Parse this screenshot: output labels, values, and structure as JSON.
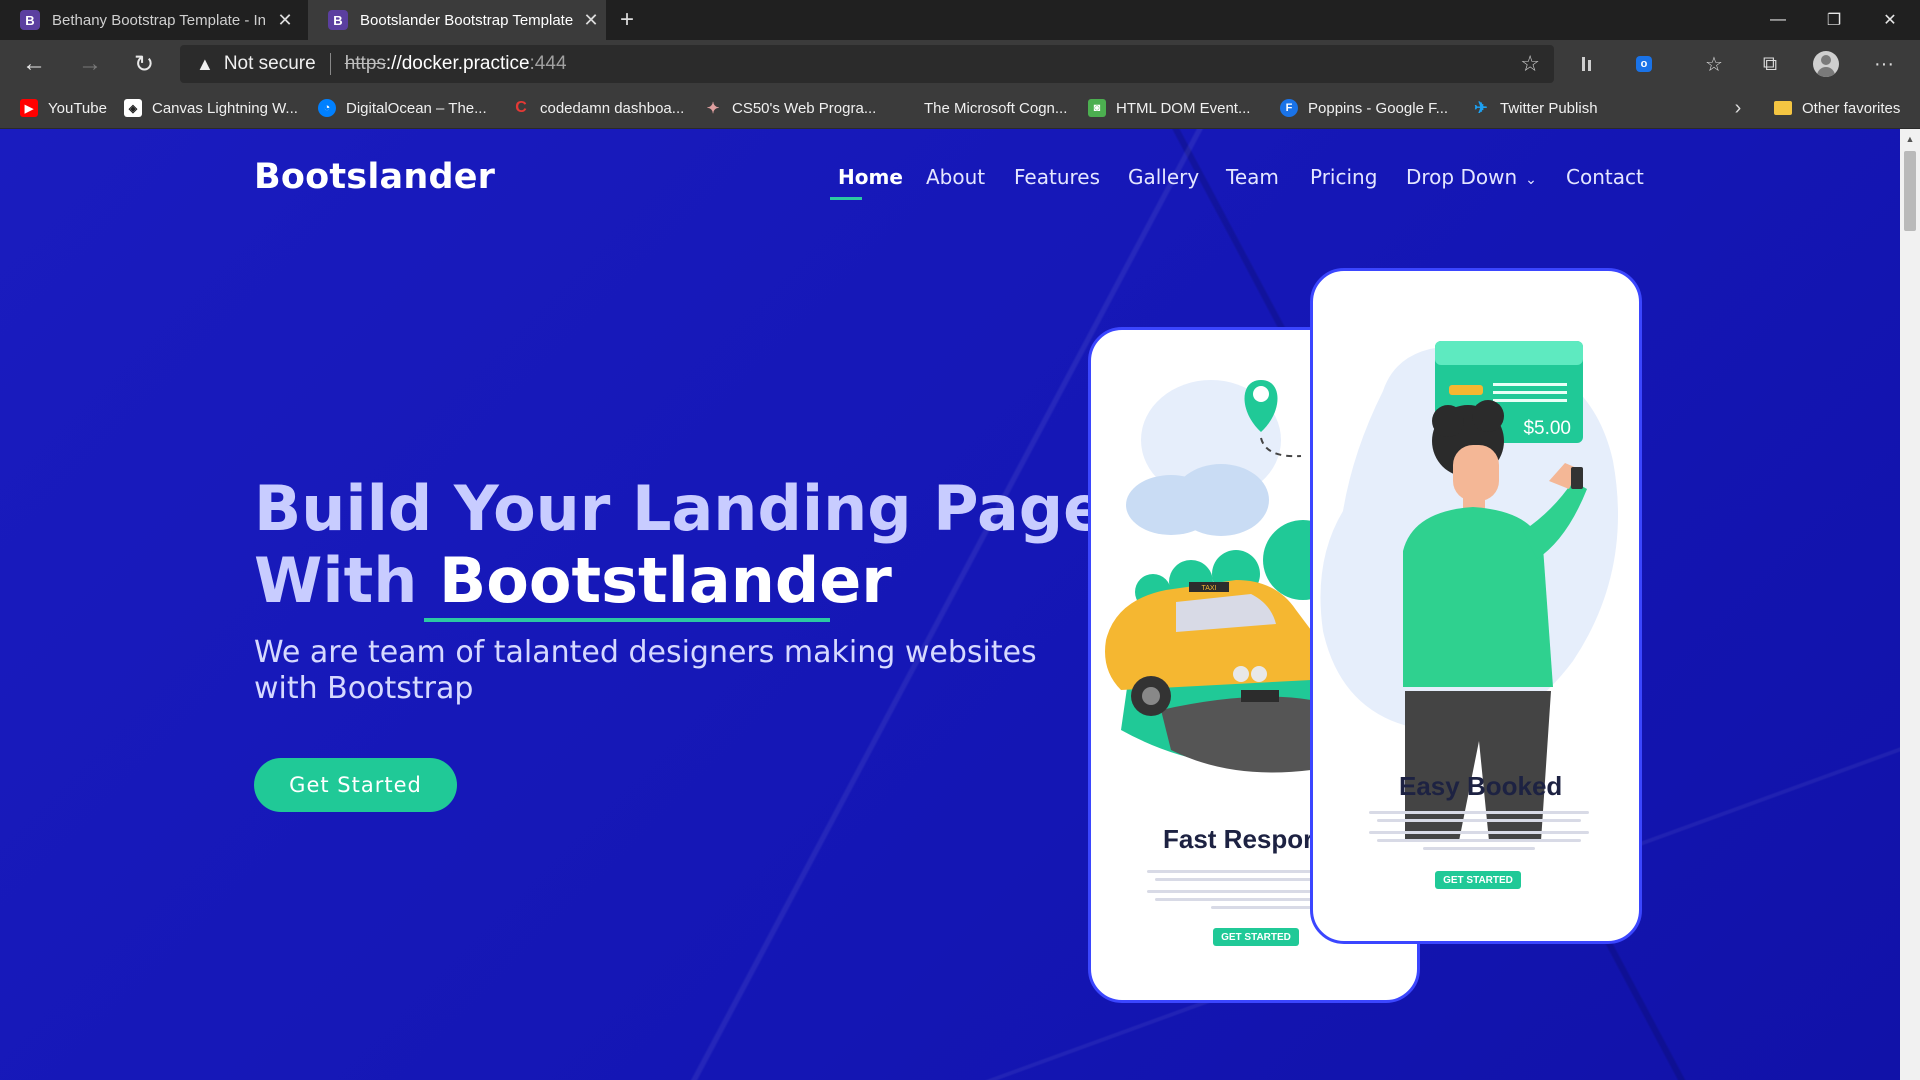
{
  "browser": {
    "tabs": [
      {
        "label": "Bethany Bootstrap Template - In",
        "favicon": "B",
        "active": false
      },
      {
        "label": "Bootslander Bootstrap Template",
        "favicon": "B",
        "active": true
      }
    ],
    "new_tab": "+",
    "window_controls": {
      "minimize": "—",
      "restore": "❐",
      "close": "✕"
    },
    "nav": {
      "back": "←",
      "forward": "→",
      "reload": "↻"
    },
    "address": {
      "warning_icon": "▲",
      "security_text": "Not secure",
      "scheme": "https",
      "rest_host": "://docker.practice",
      "port": ":444"
    },
    "toolbar_icons": [
      "extension-icon",
      "extension-badge-icon",
      "favorites-icon",
      "collections-icon",
      "profile-icon",
      "more-icon"
    ],
    "more": "···",
    "bookmarks": [
      {
        "label": "YouTube",
        "color": "#ff0000",
        "glyph": "▶"
      },
      {
        "label": "Canvas Lightning W...",
        "color": "#ffffff",
        "glyph": "◈"
      },
      {
        "label": "DigitalOcean – The...",
        "color": "#0080ff",
        "glyph": "◔"
      },
      {
        "label": "codedamn dashboa...",
        "color": "#e53935",
        "glyph": "C"
      },
      {
        "label": "CS50's Web Progra...",
        "color": "#b0b0b0",
        "glyph": "✦"
      },
      {
        "label": "The Microsoft Cogn...",
        "color": "#f25022",
        "glyph": "■"
      },
      {
        "label": "HTML DOM Event...",
        "color": "#4caf50",
        "glyph": "◙"
      },
      {
        "label": "Poppins - Google F...",
        "color": "#1a73e8",
        "glyph": "F"
      },
      {
        "label": "Twitter Publish",
        "color": "#1da1f2",
        "glyph": "✈"
      }
    ],
    "bookmarks_more": "›",
    "other_favorites": "Other favorites"
  },
  "site": {
    "logo": "Bootslander",
    "nav": [
      {
        "label": "Home",
        "active": true
      },
      {
        "label": "About",
        "active": false
      },
      {
        "label": "Features",
        "active": false
      },
      {
        "label": "Gallery",
        "active": false
      },
      {
        "label": "Team",
        "active": false
      },
      {
        "label": "Pricing",
        "active": false
      },
      {
        "label": "Drop Down",
        "active": false,
        "dropdown": true
      },
      {
        "label": "Contact",
        "active": false
      }
    ],
    "dropdown_arrow": "⌄",
    "hero": {
      "line1": "Build Your Landing Page",
      "line2_prefix": "With ",
      "line2_brand": "Bootstlander",
      "subtitle": "We are team of talanted designers making websites with Bootstrap",
      "cta": "Get Started"
    },
    "phones": {
      "back": {
        "title": "Fast Respor",
        "button": "GET STARTED",
        "taxi_sign": "TAXI"
      },
      "front": {
        "title": "Easy Booked",
        "button": "GET STARTED",
        "price": "$5.00"
      }
    },
    "colors": {
      "background": "#1517b7",
      "accent": "#20c997",
      "phone_border": "#3b46ff"
    }
  }
}
